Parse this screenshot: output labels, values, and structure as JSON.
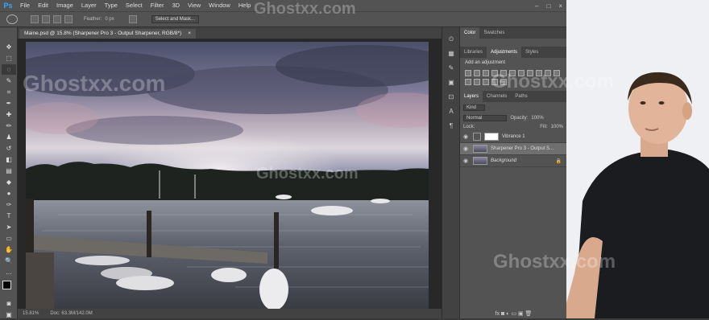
{
  "menubar": {
    "logo": "Ps",
    "items": [
      "File",
      "Edit",
      "Image",
      "Layer",
      "Type",
      "Select",
      "Filter",
      "3D",
      "View",
      "Window",
      "Help"
    ],
    "controls": [
      "–",
      "□",
      "×"
    ]
  },
  "options": {
    "feather_label": "Feather:",
    "feather_value": "0 px",
    "select_mask": "Select and Mask..."
  },
  "document": {
    "tab_title": "Maine.psd @ 15.8% (Sharpener Pro 3 - Output Sharpener, RGB/8*)",
    "tab_close": "×",
    "zoom": "15.81%",
    "doc_size": "Doc: 63.3M/142.0M"
  },
  "panels": {
    "top_tabs": [
      "Color",
      "Swatches"
    ],
    "adj_tabs": [
      "Libraries",
      "Adjustments",
      "Styles"
    ],
    "add_adjustment": "Add an adjustment",
    "layer_tabs": [
      "Layers",
      "Channels",
      "Paths"
    ],
    "kind": "Kind",
    "blend": "Normal",
    "opacity_label": "Opacity:",
    "opacity_value": "100%",
    "lock_label": "Lock:",
    "fill_label": "Fill:",
    "fill_value": "100%",
    "layers": [
      {
        "name": "Vibrance 1"
      },
      {
        "name": "Sharpener Pro 3 - Output S..."
      },
      {
        "name": "Background"
      }
    ],
    "footer_icons": "fx ◙ ◐ ▭ ▣ 🗑"
  },
  "watermark": "Ghostxx.com",
  "colors": {
    "accent": "#31a8ff",
    "chrome": "#535353",
    "canvas_bg": "#282828"
  }
}
